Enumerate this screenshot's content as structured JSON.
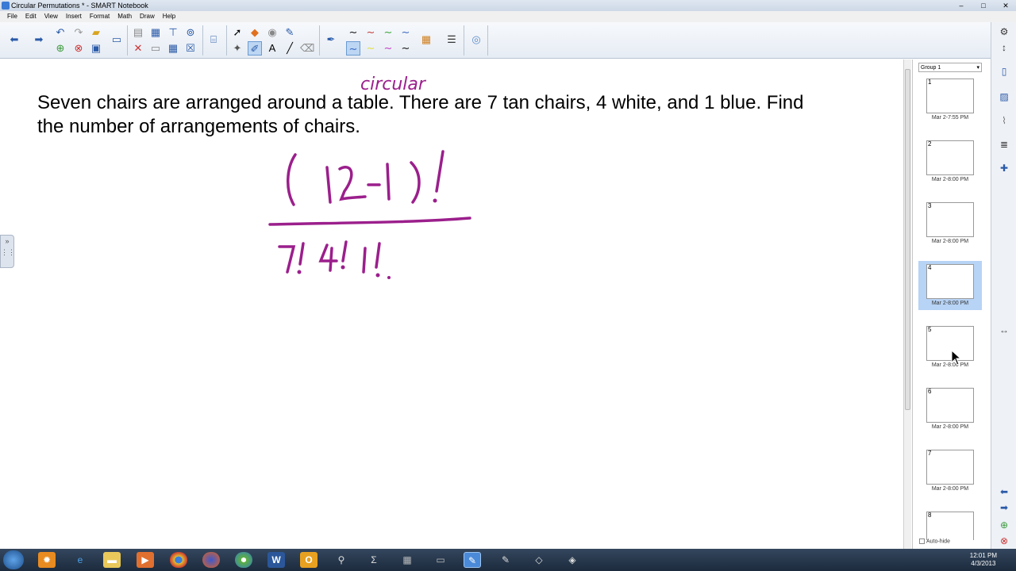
{
  "window": {
    "title": "Circular Permutations * - SMART Notebook"
  },
  "menu": [
    "File",
    "Edit",
    "View",
    "Insert",
    "Format",
    "Math",
    "Draw",
    "Help"
  ],
  "page": {
    "question": "Seven chairs are arranged around a table.  There are 7 tan chairs, 4 white, and 1 blue.  Find the number of arrangements of chairs.",
    "annotation": "circular",
    "numerator": "( 12-1 )!",
    "denominator": "7! 4! 1!"
  },
  "sorter": {
    "group": "Group 1",
    "pages": [
      {
        "num": "1",
        "date": "Mar 2-7:55 PM",
        "selected": false
      },
      {
        "num": "2",
        "date": "Mar 2-8:00 PM",
        "selected": false
      },
      {
        "num": "3",
        "date": "Mar 2-8:00 PM",
        "selected": false
      },
      {
        "num": "4",
        "date": "Mar 2-8:00 PM",
        "selected": true
      },
      {
        "num": "5",
        "date": "Mar 2-8:00 PM",
        "selected": false
      },
      {
        "num": "6",
        "date": "Mar 2-8:00 PM",
        "selected": false
      },
      {
        "num": "7",
        "date": "Mar 2-8:00 PM",
        "selected": false
      },
      {
        "num": "8",
        "date": "",
        "selected": false
      }
    ],
    "autohide_label": "Auto-hide"
  },
  "taskbar": {
    "time": "12:01 PM",
    "date": "4/3/2013"
  },
  "colors": {
    "ink": "#9b1f8c",
    "selection": "#b7d3f5"
  }
}
